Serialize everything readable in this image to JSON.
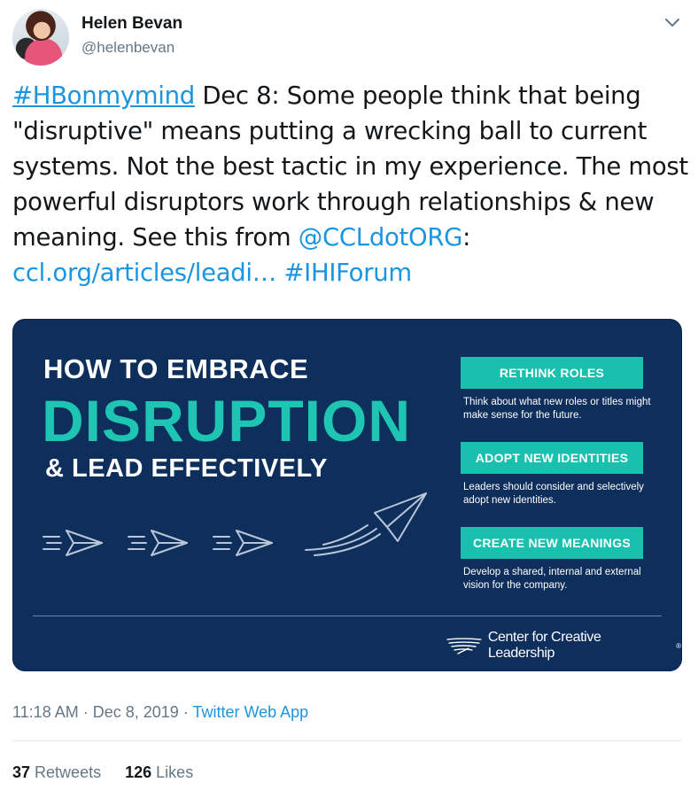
{
  "author": {
    "name": "Helen Bevan",
    "handle": "@helenbevan"
  },
  "tweet": {
    "hashtag1": "#HBonmymind",
    "text1": " Dec 8: Some people think that being \"disruptive\" means putting a wrecking ball to current systems. Not the best tactic in my experience. The most powerful disruptors work through relationships & new meaning. See this from ",
    "mention": "@CCLdotORG",
    "colon": ":",
    "url": "ccl.org/articles/leadi…",
    "hashtag2": "#IHIForum"
  },
  "card": {
    "line1": "HOW TO EMBRACE",
    "line2": "DISRUPTION",
    "line3": "& LEAD EFFECTIVELY",
    "items": [
      {
        "title": "RETHINK ROLES",
        "desc": "Think about what new roles or titles might make sense for the future."
      },
      {
        "title": "ADOPT NEW IDENTITIES",
        "desc": "Leaders should consider and selectively adopt new identities."
      },
      {
        "title": "CREATE NEW MEANINGS",
        "desc": "Develop a shared, internal and external vision for the company."
      }
    ],
    "logo_text": "Center for Creative Leadership",
    "logo_tm": "®"
  },
  "meta": {
    "time": "11:18 AM · Dec 8, 2019 · ",
    "source": "Twitter Web App"
  },
  "stats": {
    "retweets_count": "37",
    "retweets_label": "Retweets",
    "likes_count": "126",
    "likes_label": "Likes"
  },
  "icons": {
    "caret": "chevron-down-icon",
    "arrow": "paper-plane-icon"
  },
  "colors": {
    "link": "#1b95e0",
    "card_bg": "#0e2e5c",
    "teal": "#1fc5b3"
  }
}
